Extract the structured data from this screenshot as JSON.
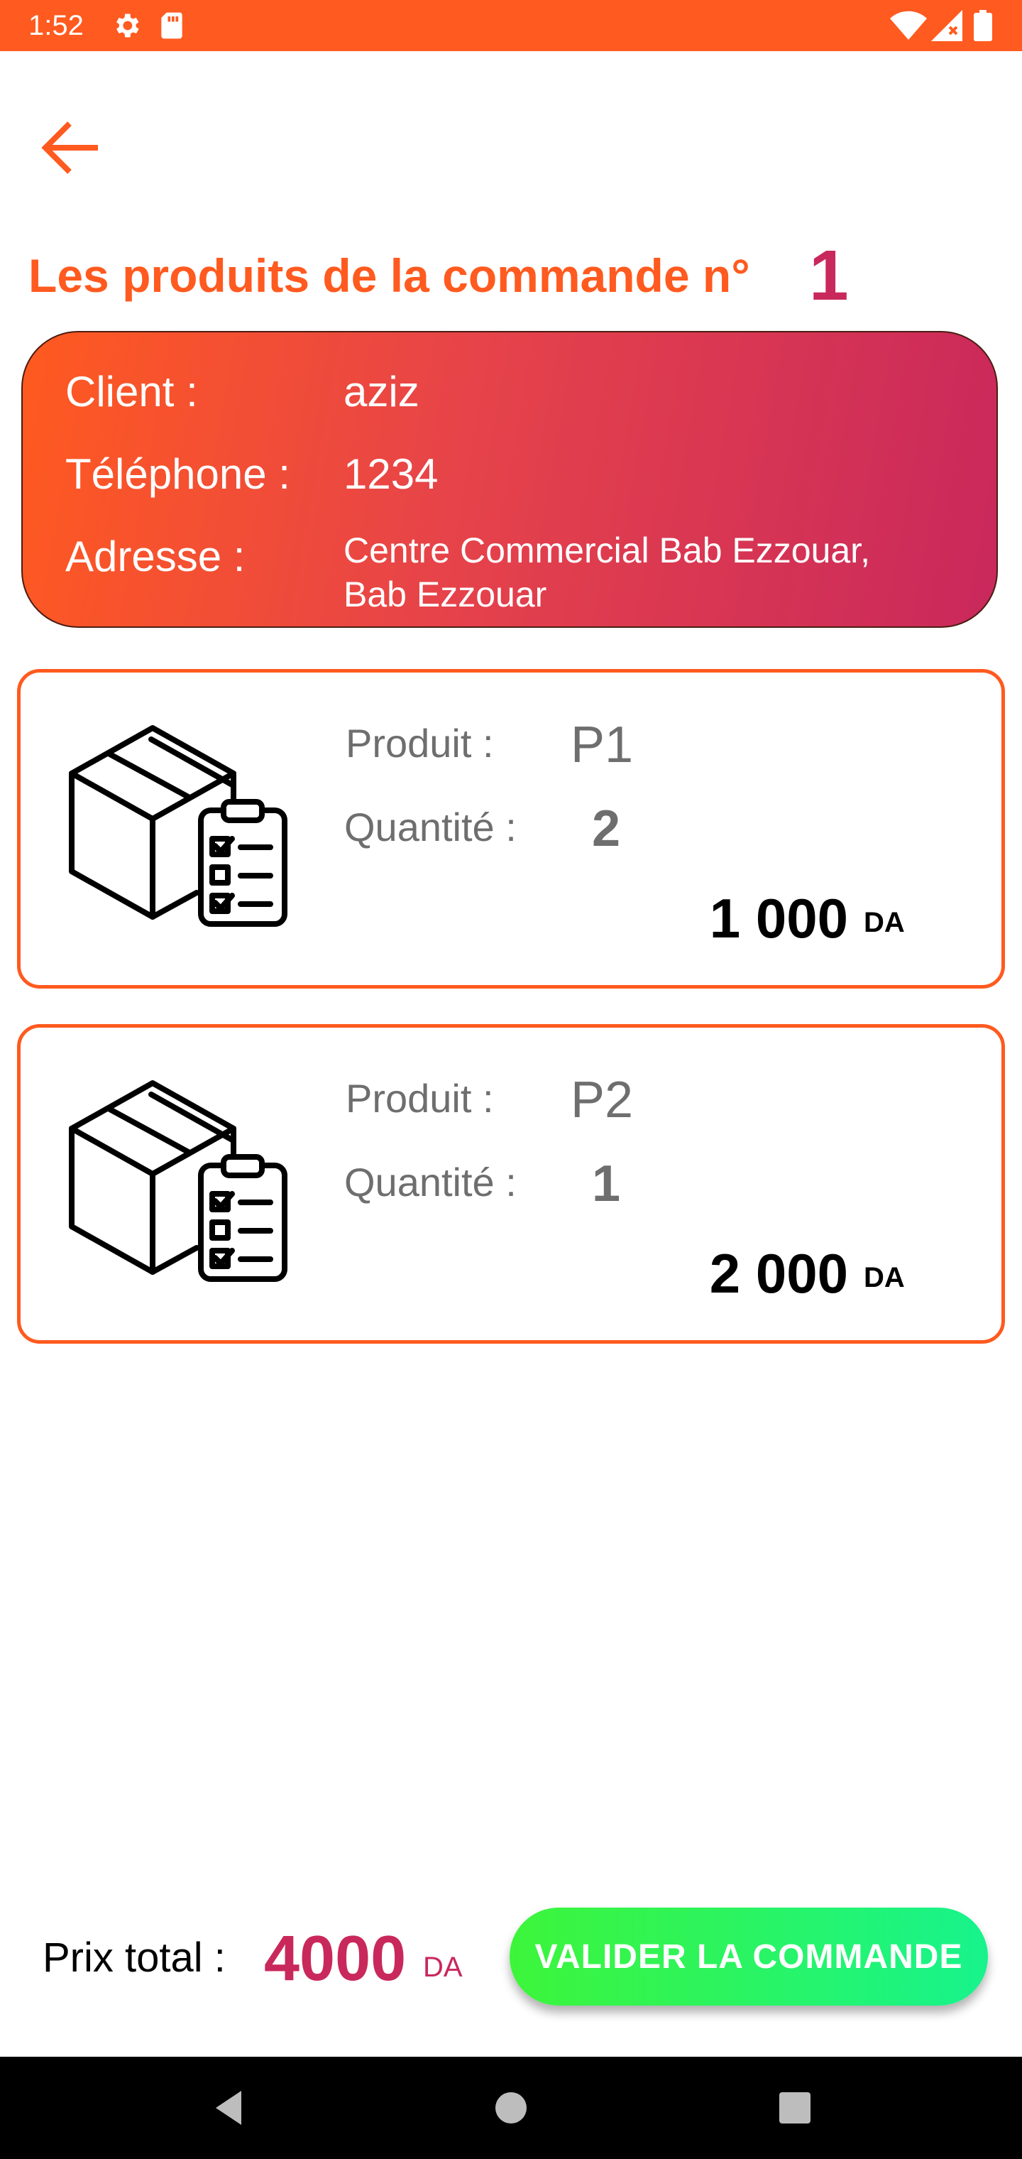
{
  "status_bar": {
    "time": "1:52",
    "icons": [
      "settings-icon",
      "sd-card-icon",
      "wifi-icon",
      "signal-icon",
      "battery-icon"
    ]
  },
  "header": {
    "back_icon": "arrow-left-icon",
    "title": "Les produits de la commande n°",
    "order_number": "1"
  },
  "client": {
    "client_label": "Client :",
    "client_value": "aziz",
    "phone_label": "Téléphone :",
    "phone_value": "1234",
    "address_label": "Adresse :",
    "address_line1": "Centre Commercial Bab Ezzouar,",
    "address_line2": "Bab Ezzouar"
  },
  "products": [
    {
      "icon": "package-checklist-icon",
      "product_label": "Produit :",
      "product_name": "P1",
      "quantity_label": "Quantité :",
      "quantity": "2",
      "price": "1 000",
      "currency": "DA"
    },
    {
      "icon": "package-checklist-icon",
      "product_label": "Produit :",
      "product_name": "P2",
      "quantity_label": "Quantité :",
      "quantity": "1",
      "price": "2 000",
      "currency": "DA"
    }
  ],
  "footer": {
    "total_label": "Prix total :",
    "total_value": "4000",
    "total_currency": "DA",
    "validate_label": "VALIDER LA COMMANDE"
  },
  "nav_bar": {
    "icons": [
      "back-triangle-icon",
      "home-circle-icon",
      "recents-square-icon"
    ]
  },
  "colors": {
    "accent_orange": "#ff5a1f",
    "accent_magenta": "#c9285c",
    "button_green_start": "#3df53a",
    "button_green_end": "#17f38c"
  }
}
